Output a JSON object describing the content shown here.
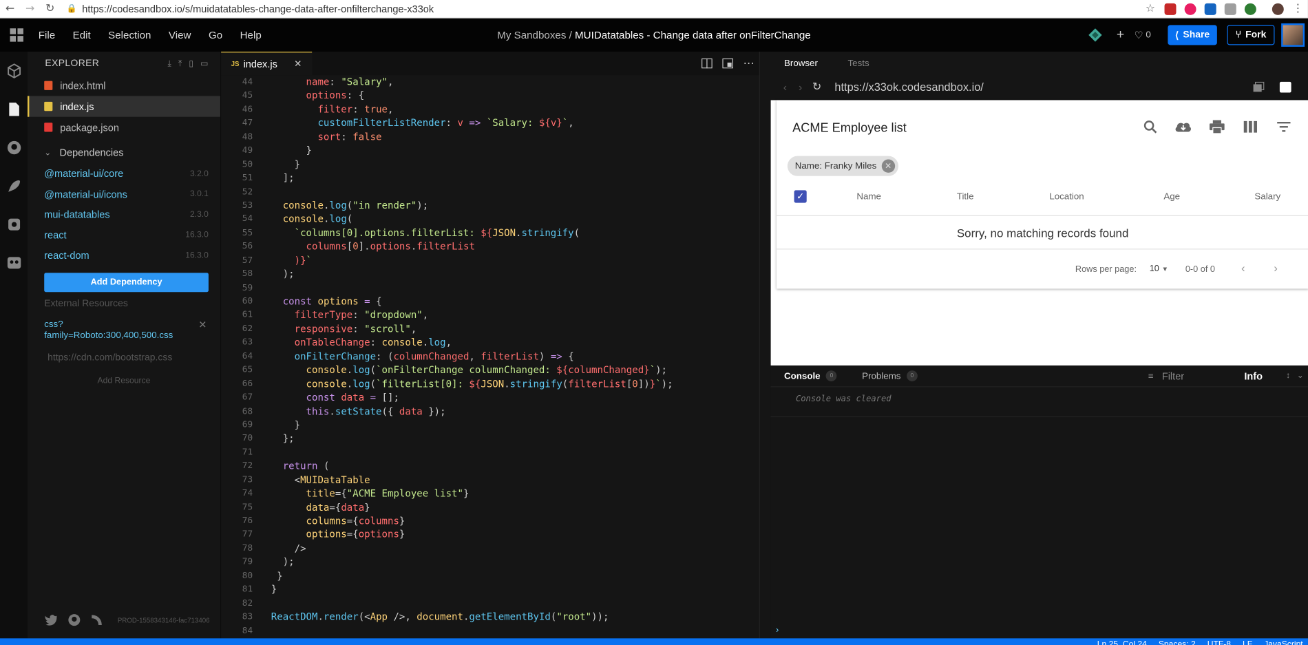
{
  "browser": {
    "url": "https://codesandbox.io/s/muidatatables-change-data-after-onfilterchange-x33ok"
  },
  "menubar": {
    "items": [
      "File",
      "Edit",
      "Selection",
      "View",
      "Go",
      "Help"
    ],
    "crumb_prefix": "My Sandboxes /",
    "crumb_title": "MUIDatatables - Change data after onFilterChange",
    "likes": "0",
    "share": "Share",
    "fork": "Fork"
  },
  "explorer": {
    "title": "Explorer",
    "files": [
      {
        "name": "index.html",
        "color": "#e4572e"
      },
      {
        "name": "index.js",
        "color": "#e4c145"
      },
      {
        "name": "package.json",
        "color": "#e53935"
      }
    ],
    "dependencies_label": "Dependencies",
    "dependencies": [
      {
        "name": "@material-ui/core",
        "version": "3.2.0"
      },
      {
        "name": "@material-ui/icons",
        "version": "3.0.1"
      },
      {
        "name": "mui-datatables",
        "version": "2.3.0"
      },
      {
        "name": "react",
        "version": "16.3.0"
      },
      {
        "name": "react-dom",
        "version": "16.3.0"
      }
    ],
    "add_dependency": "Add Dependency",
    "external_resources": "External Resources",
    "resource_line1": "css?",
    "resource_line2": "family=Roboto:300,400,500.css",
    "resource_placeholder": "https://cdn.com/bootstrap.css",
    "add_resource": "Add Resource",
    "build": "PROD-1558343146-fac713406"
  },
  "editor": {
    "tab": "index.js",
    "first_line": 44
  },
  "preview": {
    "tab_browser": "Browser",
    "tab_tests": "Tests",
    "url": "https://x33ok.codesandbox.io/",
    "table_title": "ACME Employee list",
    "chip": "Name: Franky Miles",
    "columns": [
      "Name",
      "Title",
      "Location",
      "Age",
      "Salary"
    ],
    "empty": "Sorry, no matching records found",
    "rows_per_page": "Rows per page:",
    "rows_value": "10",
    "range": "0-0 of 0"
  },
  "console": {
    "tab_console": "Console",
    "console_count": "0",
    "tab_problems": "Problems",
    "problems_count": "0",
    "filter": "Filter",
    "level": "Info",
    "message": "Console was cleared",
    "prompt": "›"
  },
  "status": {
    "position": "Ln 25, Col 24",
    "spaces": "Spaces: 2",
    "encoding": "UTF-8",
    "eol": "LF",
    "language": "JavaScript"
  },
  "colors": {
    "accent": "#0971f1",
    "dependency": "#62c6f0",
    "checkbox": "#3f51b5"
  }
}
